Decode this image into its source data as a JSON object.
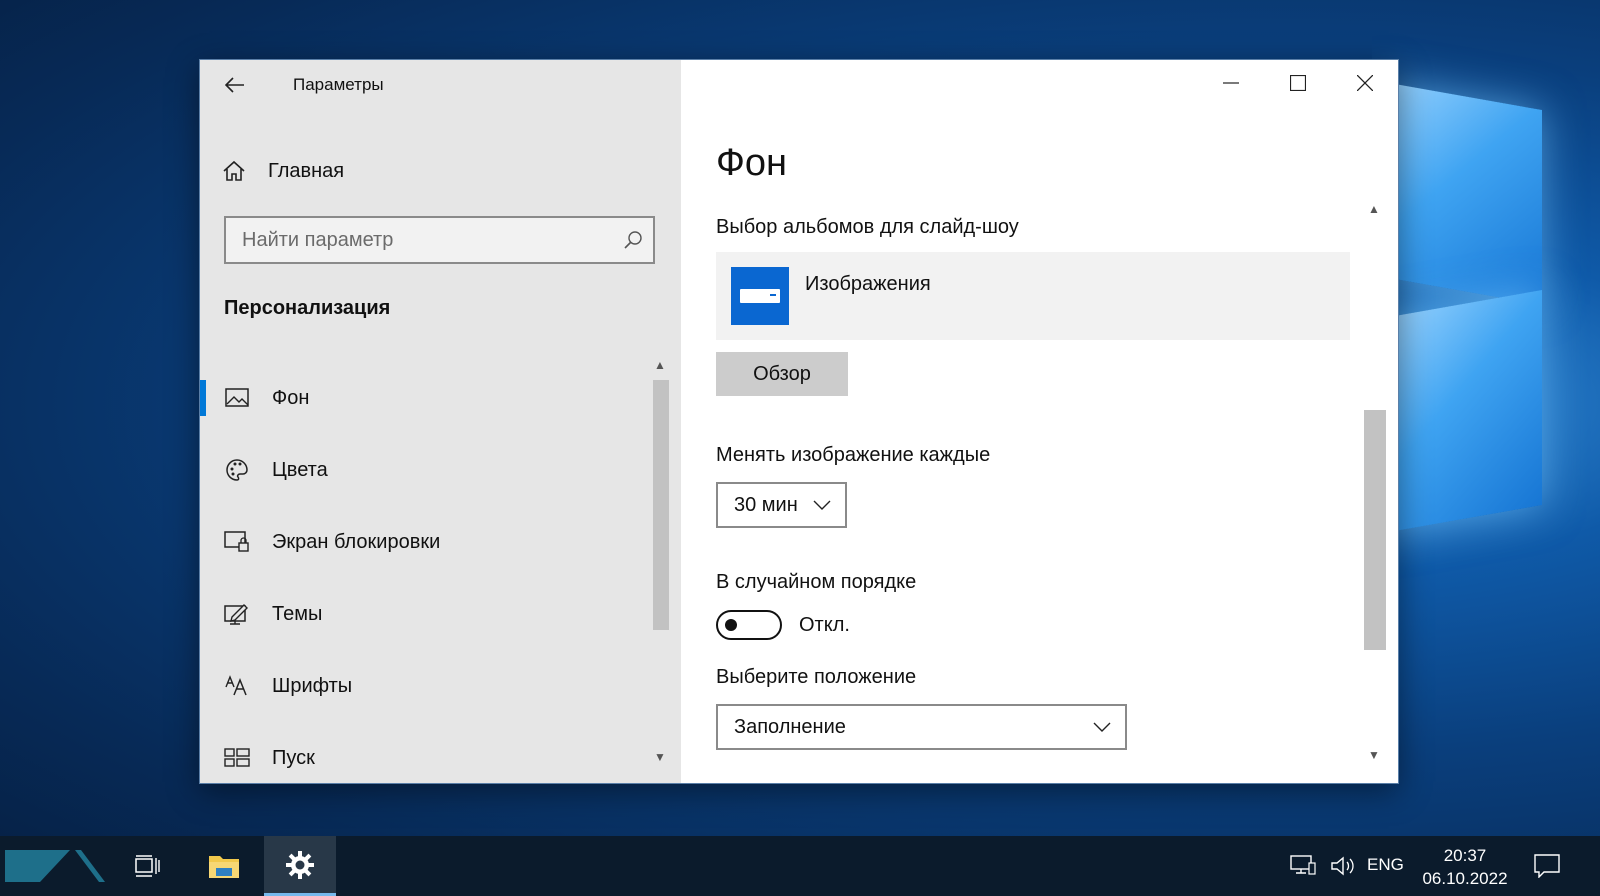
{
  "window": {
    "app_title": "Параметры"
  },
  "sidebar": {
    "home_label": "Главная",
    "search_placeholder": "Найти параметр",
    "section_title": "Персонализация",
    "items": [
      {
        "label": "Фон",
        "icon": "picture-icon",
        "active": true
      },
      {
        "label": "Цвета",
        "icon": "palette-icon",
        "active": false
      },
      {
        "label": "Экран блокировки",
        "icon": "lock-screen-icon",
        "active": false
      },
      {
        "label": "Темы",
        "icon": "themes-icon",
        "active": false
      },
      {
        "label": "Шрифты",
        "icon": "fonts-icon",
        "active": false
      },
      {
        "label": "Пуск",
        "icon": "start-icon",
        "active": false
      }
    ]
  },
  "content": {
    "page_title": "Фон",
    "album_label": "Выбор альбомов для слайд-шоу",
    "album_name": "Изображения",
    "browse_button": "Обзор",
    "interval_label": "Менять изображение каждые",
    "interval_value": "30 мин",
    "shuffle_label": "В случайном порядке",
    "shuffle_state": "Откл.",
    "fit_label": "Выберите положение",
    "fit_value": "Заполнение"
  },
  "taskbar": {
    "language": "ENG",
    "time": "20:37",
    "date": "06.10.2022"
  },
  "colors": {
    "accent": "#0078d7",
    "sidebar_bg": "#e6e6e6",
    "taskbar_bg": "#0b1b2c"
  }
}
